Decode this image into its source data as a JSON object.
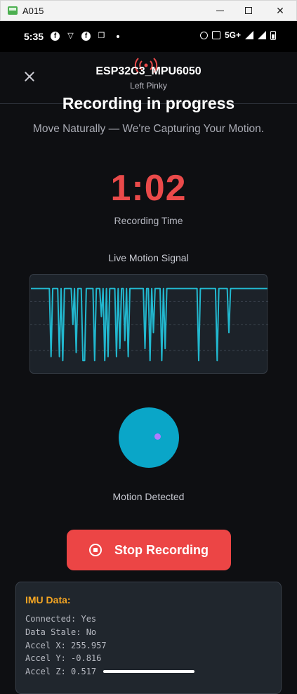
{
  "window": {
    "title": "A015"
  },
  "status_bar": {
    "time": "5:35",
    "network": "5G+"
  },
  "header": {
    "device_name": "ESP32C3_MPU6050",
    "device_sub": "Left Pinky"
  },
  "recording": {
    "headline": "Recording in progress",
    "subtitle": "Move Naturally — We're Capturing Your Motion.",
    "timer": "1:02",
    "timer_label": "Recording Time"
  },
  "signal": {
    "title": "Live Motion Signal",
    "color": "#22b8cf",
    "samples": [
      0.95,
      0.95,
      0.95,
      0.95,
      0.95,
      0.95,
      0.95,
      0.95,
      0.95,
      0.95,
      0.95,
      0.95,
      0.1,
      0.95,
      0.95,
      0.95,
      0.95,
      0.1,
      0.95,
      0.05,
      0.95,
      0.95,
      0.95,
      0.95,
      0.95,
      0.5,
      0.95,
      0.15,
      0.95,
      0.95,
      0.95,
      0.05,
      0.05,
      0.95,
      0.95,
      0.95,
      0.95,
      0.95,
      0.05,
      0.95,
      0.95,
      0.95,
      0.6,
      0.95,
      0.05,
      0.95,
      0.1,
      0.95,
      0.95,
      0.95,
      0.95,
      0.1,
      0.95,
      0.2,
      0.95,
      0.95,
      0.3,
      0.95,
      0.1,
      0.95,
      0.95,
      0.95,
      0.95,
      0.95,
      0.95,
      0.95,
      0.95,
      0.95,
      0.2,
      0.95,
      0.95,
      0.05,
      0.95,
      0.4,
      0.95,
      0.95,
      0.95,
      0.95,
      0.05,
      0.95,
      0.2,
      0.95,
      0.95,
      0.95,
      0.95,
      0.95,
      0.95,
      0.95,
      0.95,
      0.95,
      0.95,
      0.95,
      0.95,
      0.95,
      0.95,
      0.95,
      0.95,
      0.95,
      0.95,
      0.95,
      0.05,
      0.95,
      0.95,
      0.95,
      0.95,
      0.95,
      0.95,
      0.95,
      0.95,
      0.95,
      0.95,
      0.05,
      0.95,
      0.95,
      0.95,
      0.95,
      0.95,
      0.95,
      0.4,
      0.95,
      0.95,
      0.95,
      0.95,
      0.95,
      0.95,
      0.95,
      0.95,
      0.95,
      0.95,
      0.95,
      0.95,
      0.95,
      0.95,
      0.95,
      0.95,
      0.95,
      0.95,
      0.95,
      0.95,
      0.95,
      0.95,
      0.95
    ]
  },
  "motion": {
    "label": "Motion Detected",
    "circle_color": "#0aa6c8",
    "dot_color": "#b07cff"
  },
  "stop_button": {
    "label": "Stop Recording",
    "color": "#ec4545"
  },
  "imu": {
    "title": "IMU Data:",
    "lines": [
      "Connected: Yes",
      "Data Stale: No",
      "Accel X: 255.957",
      "Accel Y: -0.816",
      "Accel Z: 0.517"
    ]
  }
}
